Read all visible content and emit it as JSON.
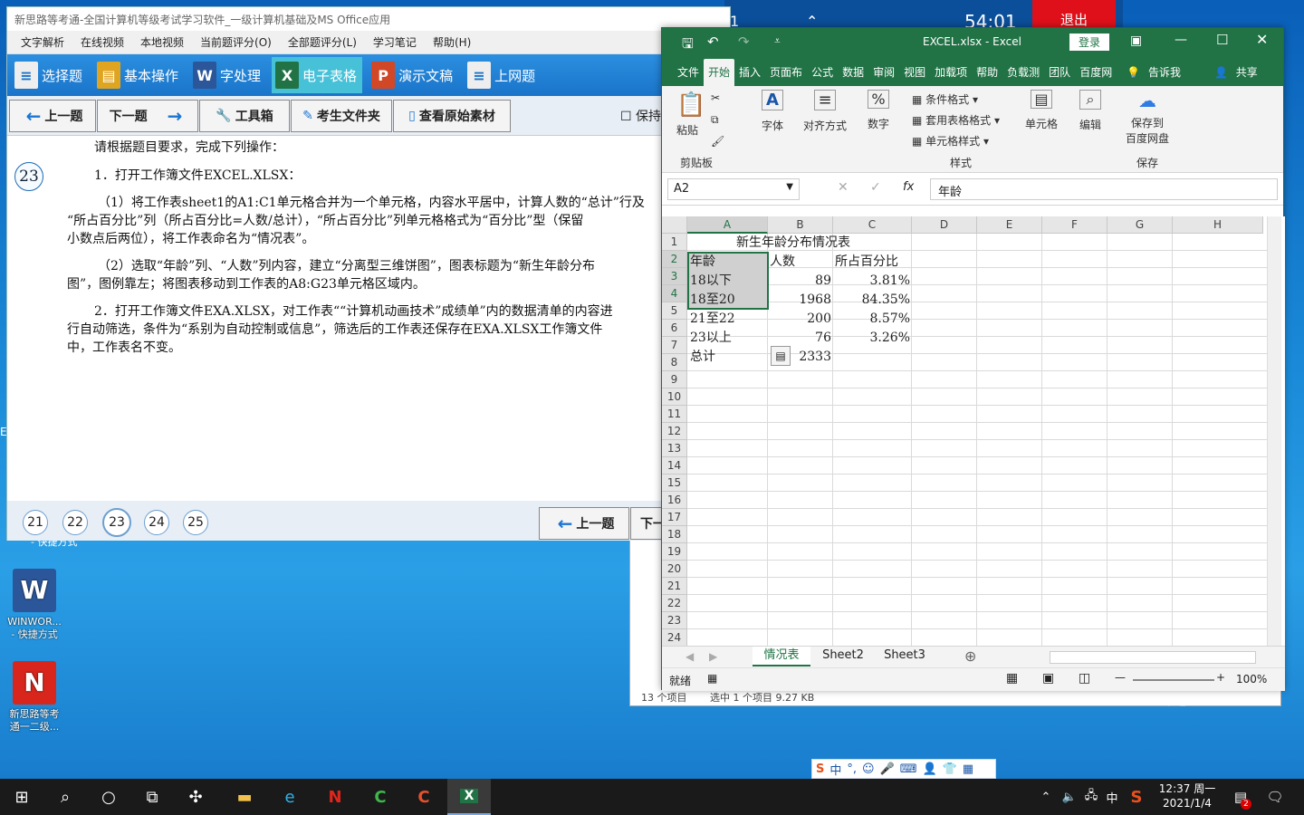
{
  "desktop": {
    "icons": [
      {
        "label": "WINWOR...\n- 快捷方式",
        "glyph": "W",
        "color": "#2b579a"
      },
      {
        "label": "新思路等考\n通一二级...",
        "glyph": "N",
        "color": "#d9261c"
      }
    ],
    "partial_label": "- 快捷方式",
    "stray_char": "E"
  },
  "exam": {
    "title": "新思路等考通-全国计算机等级考试学习软件_一级计算机基础及MS Office应用",
    "menu": [
      "文字解析",
      "在线视频",
      "本地视频",
      "当前题评分(O)",
      "全部题评分(L)",
      "学习笔记",
      "帮助(H)"
    ],
    "modules": [
      {
        "label": "选择题",
        "glyph": "≡",
        "color": "#e7e7e7"
      },
      {
        "label": "基本操作",
        "glyph": "▤",
        "color": "#e0a520"
      },
      {
        "label": "字处理",
        "glyph": "W",
        "color": "#2b579a"
      },
      {
        "label": "电子表格",
        "glyph": "X",
        "color": "#217346"
      },
      {
        "label": "演示文稿",
        "glyph": "P",
        "color": "#d24726"
      },
      {
        "label": "上网题",
        "glyph": "≡",
        "color": "#e7e7e7"
      }
    ],
    "nav": {
      "prev": "上一题",
      "next": "下一题",
      "toolbox": "工具箱",
      "folder": "考生文件夹",
      "source": "查看原始素材",
      "keep": "保持"
    },
    "qnum": "23",
    "intro": "请根据题目要求，完成下列操作：",
    "q1": "1．打开工作簿文件EXCEL.XLSX：",
    "q1_1": "（1）将工作表sheet1的A1:C1单元格合并为一个单元格，内容水平居中，计算人数的“总计”行及",
    "q1_1b": "“所占百分比”列（所占百分比=人数/总计），“所占百分比”列单元格格式为“百分比”型（保留",
    "q1_1c": "小数点后两位），将工作表命名为“情况表”。",
    "q1_2": "（2）选取“年龄”列、“人数”列内容，建立“分离型三维饼图”，图表标题为“新生年龄分布",
    "q1_2b": "图”，图例靠左；将图表移动到工作表的A8:G23单元格区域内。",
    "q2": "2．打开工作簿文件EXA.XLSX，对工作表““计算机动画技术”成绩单”内的数据清单的内容进",
    "q2b": "行自动筛选，条件为“系别为自动控制或信息”，筛选后的工作表还保存在EXA.XLSX工作簿文件",
    "q2c": "中，工作表名不变。",
    "pages": [
      "21",
      "22",
      "23",
      "24",
      "25"
    ],
    "prev2": "上一题",
    "next2": "下一"
  },
  "topbg": {
    "timer": "54:01",
    "exit": "退出",
    "partial": "1"
  },
  "explorer": {
    "items": "13 个项目",
    "selected": "选中 1 个项目  9.27 KB"
  },
  "excel": {
    "title": "EXCEL.xlsx  -  Excel",
    "login": "登录",
    "tabs": [
      "文件",
      "开始",
      "插入",
      "页面布",
      "公式",
      "数据",
      "审阅",
      "视图",
      "加载项",
      "帮助",
      "负载测",
      "团队",
      "百度网"
    ],
    "tellme": "告诉我",
    "share": "共享",
    "ribbon": {
      "paste": "粘贴",
      "clipboard": "剪贴板",
      "font": "字体",
      "align": "对齐方式",
      "number": "数字",
      "cond": "条件格式",
      "table": "套用表格格式",
      "cellstyle": "单元格样式",
      "styles": "样式",
      "cells": "单元格",
      "edit": "编辑",
      "save1": "保存到",
      "save2": "百度网盘",
      "savegrp": "保存"
    },
    "namebox": "A2",
    "formula": "年龄",
    "cols": [
      "A",
      "B",
      "C",
      "D",
      "E",
      "F",
      "G",
      "H"
    ],
    "rows": [
      "1",
      "2",
      "3",
      "4",
      "5",
      "6",
      "7",
      "8",
      "9",
      "10",
      "11",
      "12",
      "13",
      "14",
      "15",
      "16",
      "17",
      "18",
      "19",
      "20",
      "21",
      "22",
      "23",
      "24"
    ],
    "sheet": {
      "title": "新生年龄分布情况表",
      "headers": [
        "年龄",
        "人数",
        "所占百分比"
      ],
      "data": [
        [
          "18以下",
          "89",
          "3.81%"
        ],
        [
          "18至20",
          "1968",
          "84.35%"
        ],
        [
          "21至22",
          "200",
          "8.57%"
        ],
        [
          "23以上",
          "76",
          "3.26%"
        ]
      ],
      "total": [
        "总计",
        "2333"
      ]
    },
    "sheettabs": [
      "情况表",
      "Sheet2",
      "Sheet3"
    ],
    "status": "就绪",
    "zoom": "100%"
  },
  "tray": {
    "time": "12:37 周一",
    "date": "2021/1/4",
    "ime": "中",
    "notif": "2"
  },
  "colors": {
    "excel": "#217346",
    "accent": "#1a74c9"
  }
}
